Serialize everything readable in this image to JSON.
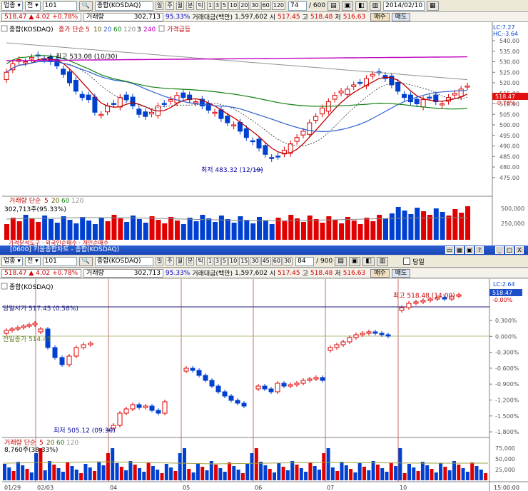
{
  "toolbar": {
    "sector": "업종",
    "mode": "전",
    "code": "101",
    "search": "",
    "name": "종합(KOSDAQ)",
    "unit_day": "일",
    "unit_week": "주",
    "unit_month": "월",
    "unit_min": "분",
    "unit_tick": "틱",
    "intervals": [
      "1",
      "3",
      "5",
      "10",
      "20",
      "30",
      "60",
      "120"
    ],
    "count": "74",
    "count_total": "/ 600",
    "date": "2014/02/10"
  },
  "quote": {
    "price": "518.47",
    "arrow": "▲",
    "change": "4.02",
    "pct": "+0.78%",
    "vol_label": "거래량",
    "vol": "302,713",
    "vol_ratio": "95.33%",
    "amount_label": "거래대금(백만)",
    "amount": "1,597,602",
    "open_label": "시",
    "open": "517.45",
    "high_label": "고",
    "high": "518.48",
    "low_label": "저",
    "low": "516.63",
    "buy": "매수",
    "sell": "매도"
  },
  "daily": {
    "legend_name": "종합(KOSDAQ)",
    "legend_ma": "종가 단순",
    "legend_p": [
      "5",
      "10",
      "20",
      "60",
      "120",
      "3",
      "240"
    ],
    "legend_extra": "가격급등",
    "max_label": "최고 533.08 (10/30)",
    "min_label": "최저 483.32 (12/19)",
    "lc": "LC:7.27",
    "hc": "HC:-3.64",
    "cur": "518.47",
    "cur_pct": "-0.78%",
    "yticks": [
      "540.00",
      "535.00",
      "530.00",
      "525.00",
      "520.00",
      "515.00",
      "510.00",
      "505.00",
      "500.00",
      "495.00",
      "490.00",
      "485.00",
      "480.00",
      "475.00"
    ],
    "vol_legend": "거래량 단순",
    "vol_p": [
      "5",
      "20",
      "60",
      "120"
    ],
    "vol_value": "302,713주(95.33%)",
    "vol_ticks": [
      "500,000",
      "250,000"
    ],
    "bottom_legend": "가격분석도구 · 외국인순매수 · 개인순매수"
  },
  "window": {
    "title": "[0600] 키움종합차트 - 종합(KOSDAQ)",
    "min": "_",
    "max": "□",
    "close": "X"
  },
  "toolbar2": {
    "intervals": [
      "1",
      "3",
      "5",
      "10",
      "15",
      "30",
      "45",
      "60",
      "30"
    ],
    "count": "84",
    "count_total": "/ 900",
    "today": "당일"
  },
  "intraday": {
    "legend_name": "종합(KOSDAQ)",
    "lc": "LC:2.64",
    "cur": "518.47",
    "cur_pct": "-0.00%",
    "open_label": "당일시가 517.45 (0.58%)",
    "prev_label": "전일종가 514.45",
    "max_label": "최고 518.48 (14:00)",
    "min_label": "최저 505.12 (09:30)",
    "yticks": [
      "0.300%",
      "0.000%",
      "-0.300%",
      "-0.600%",
      "-0.900%",
      "-1.200%",
      "-1.500%",
      "-1.800%"
    ],
    "vol_legend": "거래량 단순",
    "vol_p": [
      "5",
      "20",
      "60",
      "120"
    ],
    "vol_value": "8,760주(38.33%)",
    "vol_ticks": [
      "75,000",
      "50,000",
      "25,000"
    ],
    "xlabels": [
      "01/29",
      "02/03",
      "04",
      "05",
      "06",
      "07",
      "10",
      "15:00:00"
    ]
  },
  "colors": {
    "up": "#e00000",
    "down": "#0040d0",
    "ma5": "#c00000",
    "ma20": "#3060d0",
    "ma60": "#108010",
    "ma120": "#909090",
    "ma240": "#c000c0"
  }
}
